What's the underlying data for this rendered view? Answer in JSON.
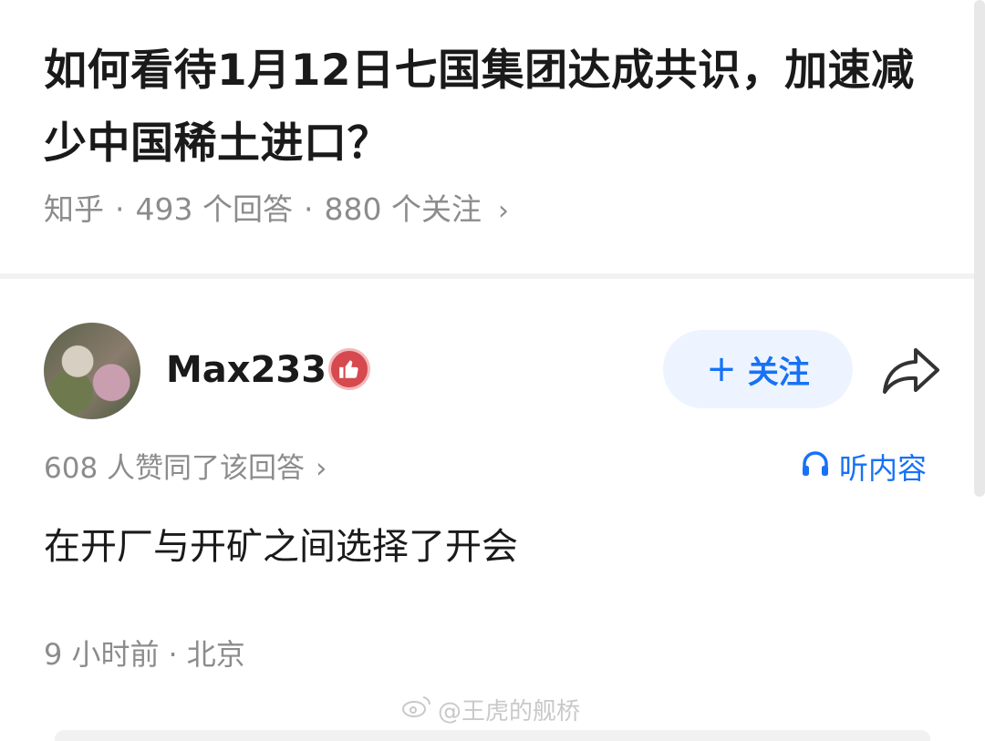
{
  "question": {
    "title": "如何看待1月12日七国集团达成共识，加速减少中国稀土进口？",
    "source": "知乎",
    "answer_count": "493 个回答",
    "follower_count": "880 个关注",
    "chevron": "›"
  },
  "answer": {
    "author": {
      "name": "Max233",
      "badge_icon": "thumbs-up-icon",
      "avatar_icon": "bird-blossom-avatar"
    },
    "follow_button": {
      "plus": "+",
      "label": "关注"
    },
    "share_icon": "share-arrow-icon",
    "upvote_text": "608 人赞同了该回答",
    "upvote_chevron": "›",
    "listen": {
      "icon": "headphones-icon",
      "label": "听内容"
    },
    "content": "在开厂与开矿之间选择了开会",
    "time": "9 小时前",
    "location": "北京"
  },
  "watermark": {
    "icon": "weibo-icon",
    "text": "@王虎的舰桥"
  },
  "colors": {
    "accent": "#1772f6",
    "muted": "#8c8c8c",
    "badge": "#d5494f",
    "follow_bg": "#eef4ff"
  }
}
